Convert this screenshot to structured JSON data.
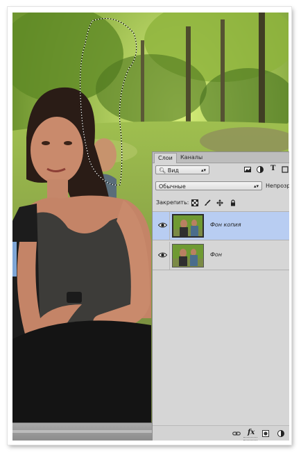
{
  "panel": {
    "tabs": [
      {
        "label": "Слои"
      },
      {
        "label": "Каналы"
      }
    ],
    "filter": {
      "label": "Вид",
      "search_icon": "search-icon"
    },
    "filter_icons": [
      "image-filter-icon",
      "adjustment-filter-icon",
      "type-filter-icon",
      "shape-filter-icon"
    ],
    "blend_mode": {
      "value": "Обычные"
    },
    "opacity": {
      "label": "Непрозр"
    },
    "lock": {
      "label": "Закрепить:",
      "icons": [
        "lock-transparent-icon",
        "lock-brush-icon",
        "lock-move-icon",
        "lock-all-icon"
      ]
    },
    "layers": [
      {
        "name": "Фон копия",
        "visible": true,
        "selected": true
      },
      {
        "name": "Фон",
        "visible": true,
        "selected": false
      }
    ],
    "footer_icons": [
      "link-icon",
      "fx-icon",
      "mask-icon",
      "adjustment-icon"
    ],
    "footer_fx_label": "fx"
  },
  "colors": {
    "selected_layer": "#b8cdf2",
    "panel_bg": "#d6d6d6"
  }
}
